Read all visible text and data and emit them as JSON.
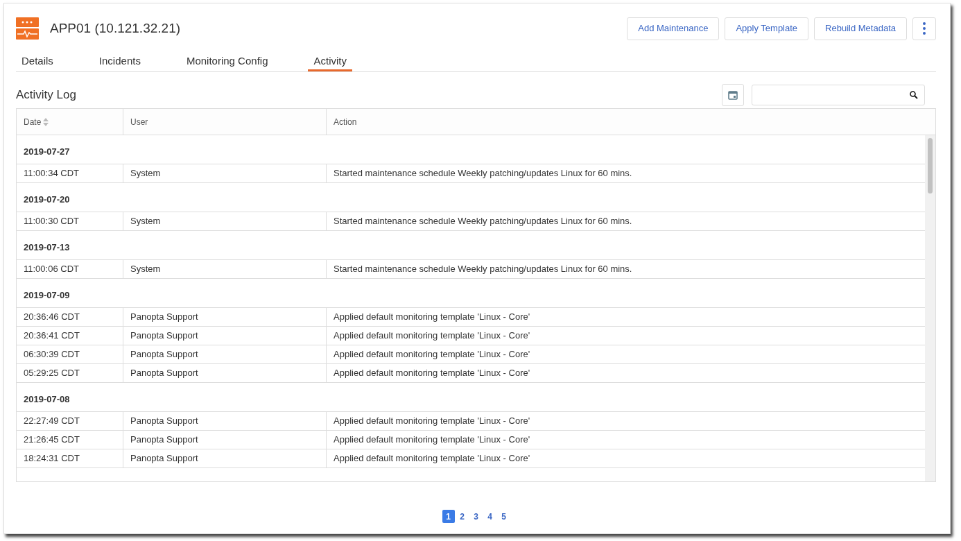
{
  "header": {
    "title": "APP01 (10.121.32.21)",
    "buttons": [
      "Add Maintenance",
      "Apply Template",
      "Rebuild Metadata"
    ]
  },
  "tabs": [
    {
      "label": "Details",
      "selected": false
    },
    {
      "label": "Incidents",
      "selected": false
    },
    {
      "label": "Monitoring Config",
      "selected": false
    },
    {
      "label": "Activity",
      "selected": true
    }
  ],
  "section_title": "Activity Log",
  "table": {
    "columns": [
      {
        "label": "Date",
        "sortable": true
      },
      {
        "label": "User",
        "sortable": false
      },
      {
        "label": "Action",
        "sortable": false
      }
    ],
    "groups": [
      {
        "date": "2019-07-27",
        "rows": [
          {
            "time": "11:00:34 CDT",
            "user": "System",
            "action": "Started maintenance schedule Weekly patching/updates Linux for 60 mins."
          }
        ]
      },
      {
        "date": "2019-07-20",
        "rows": [
          {
            "time": "11:00:30 CDT",
            "user": "System",
            "action": "Started maintenance schedule Weekly patching/updates Linux for 60 mins."
          }
        ]
      },
      {
        "date": "2019-07-13",
        "rows": [
          {
            "time": "11:00:06 CDT",
            "user": "System",
            "action": "Started maintenance schedule Weekly patching/updates Linux for 60 mins."
          }
        ]
      },
      {
        "date": "2019-07-09",
        "rows": [
          {
            "time": "20:36:46 CDT",
            "user": "Panopta Support",
            "action": "Applied default monitoring template 'Linux - Core'"
          },
          {
            "time": "20:36:41 CDT",
            "user": "Panopta Support",
            "action": "Applied default monitoring template 'Linux - Core'"
          },
          {
            "time": "06:30:39 CDT",
            "user": "Panopta Support",
            "action": "Applied default monitoring template 'Linux - Core'"
          },
          {
            "time": "05:29:25 CDT",
            "user": "Panopta Support",
            "action": "Applied default monitoring template 'Linux - Core'"
          }
        ]
      },
      {
        "date": "2019-07-08",
        "rows": [
          {
            "time": "22:27:49 CDT",
            "user": "Panopta Support",
            "action": "Applied default monitoring template 'Linux - Core'"
          },
          {
            "time": "21:26:45 CDT",
            "user": "Panopta Support",
            "action": "Applied default monitoring template 'Linux - Core'"
          },
          {
            "time": "18:24:31 CDT",
            "user": "Panopta Support",
            "action": "Applied default monitoring template 'Linux - Core'"
          }
        ]
      }
    ]
  },
  "pagination": [
    {
      "label": "1",
      "selected": true
    },
    {
      "label": "2",
      "selected": false
    },
    {
      "label": "3",
      "selected": false
    },
    {
      "label": "4",
      "selected": false
    },
    {
      "label": "5",
      "selected": false
    }
  ]
}
